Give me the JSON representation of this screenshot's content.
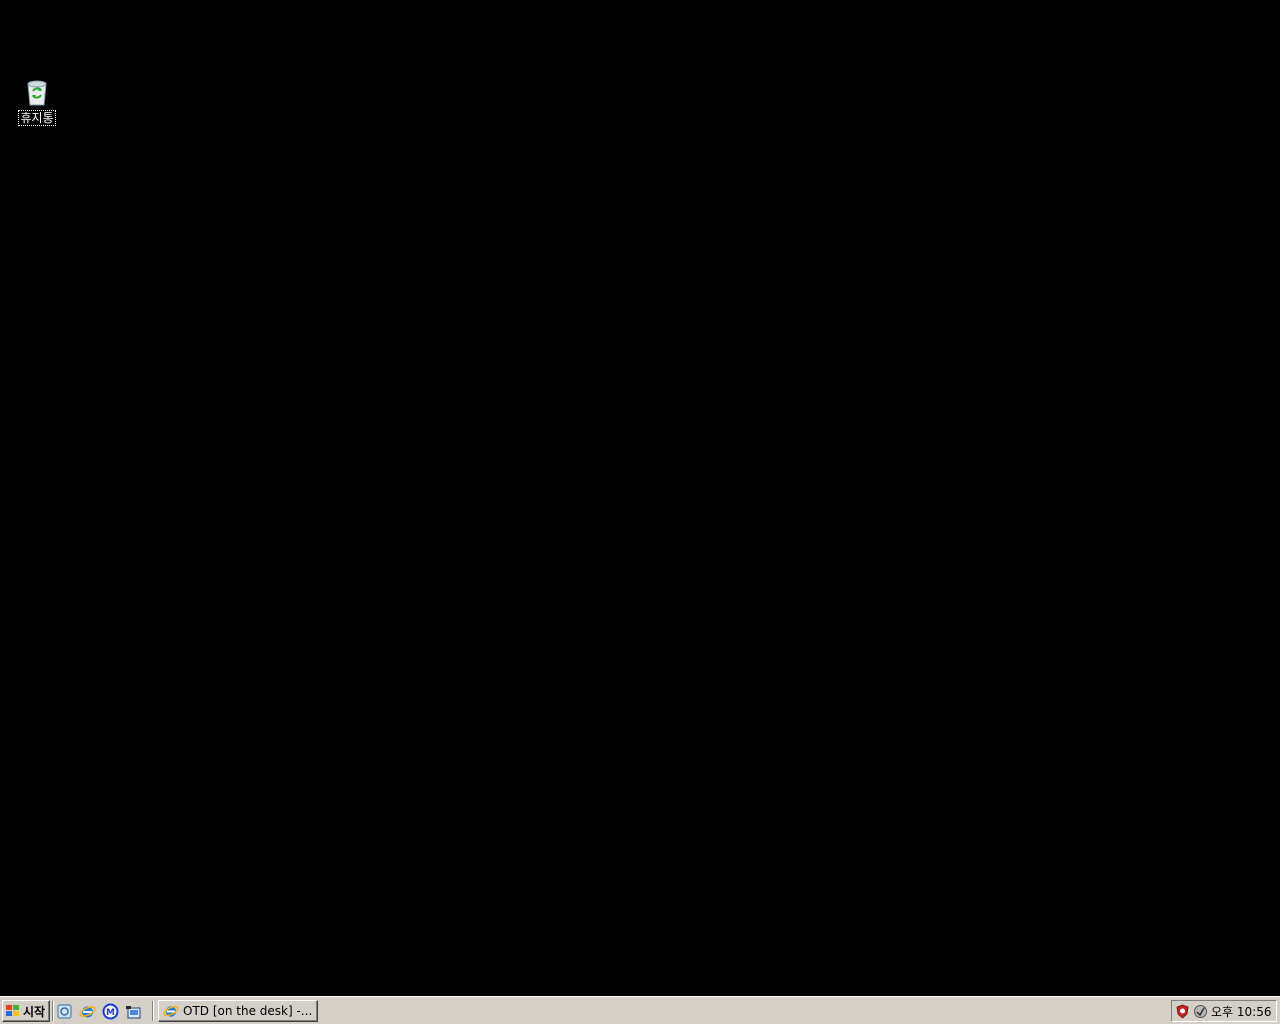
{
  "desktop": {
    "background_color": "#000000",
    "icons": [
      {
        "label": "휴지통",
        "icon": "recycle-bin-icon"
      }
    ]
  },
  "taskbar": {
    "start_label": "시작",
    "start_icon": "windows-logo-icon",
    "quick_launch": [
      {
        "icon": "show-desktop-icon"
      },
      {
        "icon": "internet-explorer-icon"
      },
      {
        "icon": "messenger-m-icon"
      },
      {
        "icon": "app-shortcut-icon"
      }
    ],
    "tasks": [
      {
        "label": "OTD [on the desk] -...",
        "icon": "internet-explorer-icon"
      }
    ],
    "tray": {
      "icons": [
        "security-shield-icon",
        "network-status-icon"
      ],
      "clock": "오후 10:56"
    }
  }
}
